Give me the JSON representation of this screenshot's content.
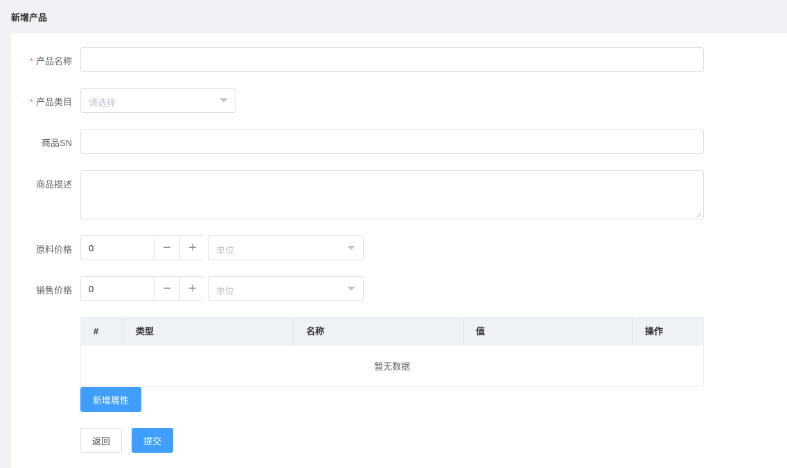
{
  "header": {
    "title": "新增产品"
  },
  "form": {
    "name": {
      "label": "产品名称",
      "required_mark": "*",
      "value": ""
    },
    "category": {
      "label": "产品类目",
      "required_mark": "*",
      "placeholder": "请选择"
    },
    "sn": {
      "label": "商品SN",
      "value": ""
    },
    "description": {
      "label": "商品描述",
      "value": ""
    },
    "raw_price": {
      "label": "原料价格",
      "value": "0",
      "minus": "−",
      "plus": "+",
      "unit_placeholder": "单位"
    },
    "sale_price": {
      "label": "销售价格",
      "value": "0",
      "minus": "−",
      "plus": "+",
      "unit_placeholder": "单位"
    }
  },
  "attributes_table": {
    "columns": [
      "#",
      "类型",
      "名称",
      "值",
      "操作"
    ],
    "rows": [],
    "empty_text": "暂无数据"
  },
  "buttons": {
    "add_attribute": "新增属性",
    "back": "返回",
    "submit": "提交"
  },
  "colors": {
    "primary": "#409eff",
    "required": "#f56c6c",
    "border": "#dcdfe6",
    "page_bg": "#f0f2f5"
  },
  "icons": {
    "select_caret": "caret-down-icon",
    "minus": "minus-icon",
    "plus": "plus-icon",
    "resize": "resize-handle-icon"
  }
}
